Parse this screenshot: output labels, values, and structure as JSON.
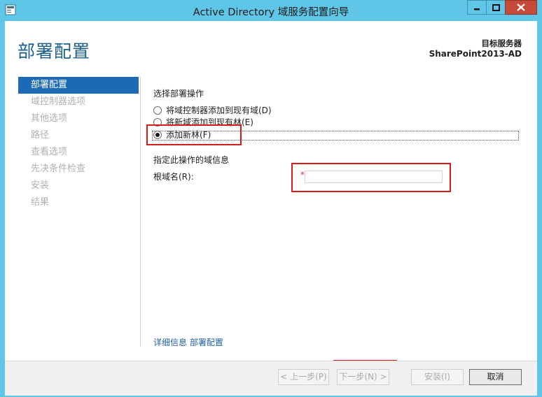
{
  "window": {
    "title": "Active Directory 域服务配置向导",
    "controls": {
      "minimize": "▬",
      "maximize": "▢",
      "close": "✕"
    },
    "frame_color": "#5fc6e8",
    "close_color": "#c7493a"
  },
  "header": {
    "page_title": "部署配置",
    "target_label": "目标服务器",
    "target_server": "SharePoint2013-AD"
  },
  "nav": {
    "items": [
      {
        "label": "部署配置",
        "active": true
      },
      {
        "label": "域控制器选项",
        "active": false
      },
      {
        "label": "其他选项",
        "active": false
      },
      {
        "label": "路径",
        "active": false
      },
      {
        "label": "查看选项",
        "active": false
      },
      {
        "label": "先决条件检查",
        "active": false
      },
      {
        "label": "安装",
        "active": false
      },
      {
        "label": "结果",
        "active": false
      }
    ],
    "active_color": "#1c6ab4"
  },
  "content": {
    "operation_heading": "选择部署操作",
    "options": [
      {
        "label": "将域控制器添加到现有域(D)",
        "checked": false
      },
      {
        "label": "将新域添加到现有林(E)",
        "checked": false
      },
      {
        "label": "添加新林(F)",
        "checked": true
      }
    ],
    "domain_info_heading": "指定此操作的域信息",
    "root_domain_label": "根域名(R):",
    "root_domain_required": "*",
    "root_domain_value": "",
    "more_info_link": "详细信息 部署配置"
  },
  "footer": {
    "back": "< 上一步(P)",
    "next": "下一步(N) >",
    "install": "安装(I)",
    "cancel": "取消"
  },
  "annotation_color": "#d41c1c"
}
